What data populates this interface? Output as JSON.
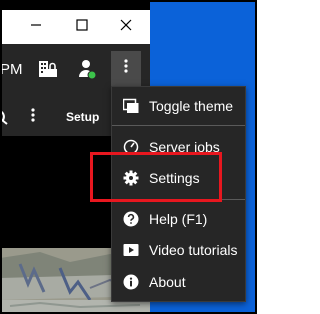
{
  "header": {
    "clock_fragment": "PM",
    "icons": [
      "building-lock-icon",
      "user-status-icon",
      "more-vertical-icon"
    ]
  },
  "window_controls": [
    "minimize-icon",
    "maximize-icon",
    "close-icon"
  ],
  "toolbar": {
    "setup_label": "Setup"
  },
  "menu": {
    "items": [
      {
        "label": "Toggle theme",
        "icon": "toggle-theme-icon"
      },
      {
        "label": "Server jobs",
        "icon": "gauge-icon"
      },
      {
        "label": "Settings",
        "icon": "gear-icon"
      },
      {
        "label": "Help (F1)",
        "icon": "help-circle-icon"
      },
      {
        "label": "Video tutorials",
        "icon": "play-video-icon"
      },
      {
        "label": "About",
        "icon": "info-circle-icon"
      }
    ]
  },
  "colors": {
    "menu_bg": "#262626",
    "menu_text": "#ffffff",
    "highlight": "#e8171f",
    "desktop": "#0b62d9",
    "status_dot": "#3cc34b"
  }
}
